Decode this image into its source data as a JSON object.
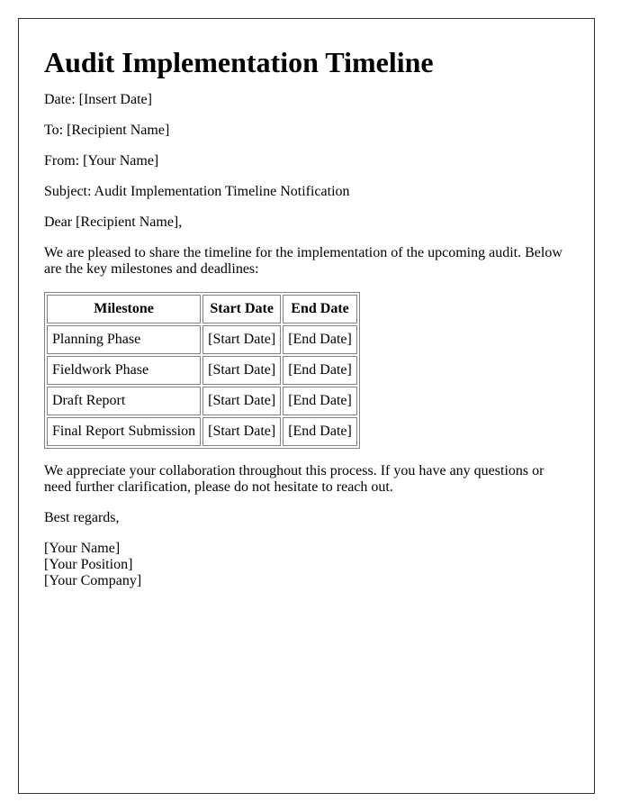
{
  "title": "Audit Implementation Timeline",
  "header_lines": {
    "date": "Date: [Insert Date]",
    "to": "To: [Recipient Name]",
    "from": "From: [Your Name]",
    "subject": "Subject: Audit Implementation Timeline Notification"
  },
  "salutation": "Dear [Recipient Name],",
  "intro": "We are pleased to share the timeline for the implementation of the upcoming audit. Below are the key milestones and deadlines:",
  "table": {
    "headers": [
      "Milestone",
      "Start Date",
      "End Date"
    ],
    "rows": [
      [
        "Planning Phase",
        "[Start Date]",
        "[End Date]"
      ],
      [
        "Fieldwork Phase",
        "[Start Date]",
        "[End Date]"
      ],
      [
        "Draft Report",
        "[Start Date]",
        "[End Date]"
      ],
      [
        "Final Report Submission",
        "[Start Date]",
        "[End Date]"
      ]
    ]
  },
  "closing_paragraph": "We appreciate your collaboration throughout this process. If you have any questions or need further clarification, please do not hesitate to reach out.",
  "sign_off": "Best regards,",
  "signature": {
    "name": "[Your Name]",
    "position": "[Your Position]",
    "company": "[Your Company]"
  }
}
